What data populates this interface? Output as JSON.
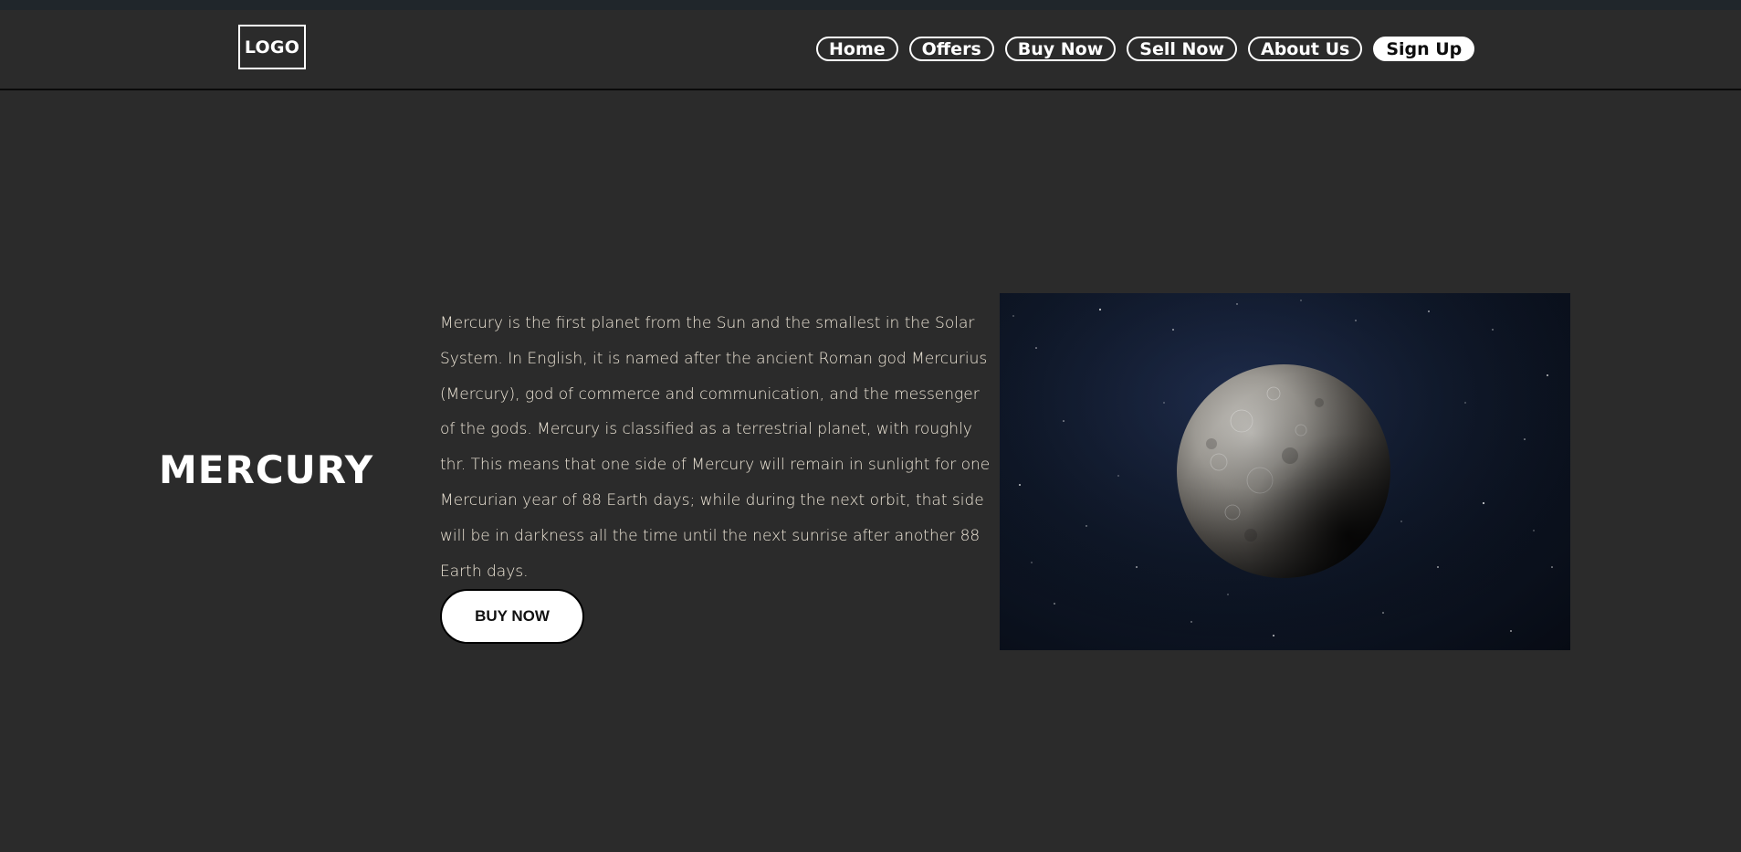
{
  "header": {
    "logo_text": "LOGO",
    "nav": [
      {
        "label": "Home"
      },
      {
        "label": "Offers"
      },
      {
        "label": "Buy Now"
      },
      {
        "label": "Sell Now"
      },
      {
        "label": "About Us"
      },
      {
        "label": "Sign Up"
      }
    ]
  },
  "main": {
    "title": "mercury",
    "description": "Mercury is the first planet from the Sun and the smallest in the Solar System. In English, it is named after the ancient Roman god Mercurius (Mercury), god of commerce and communication, and the messenger of the gods. Mercury is classified as a terrestrial planet, with roughly thr. This means that one side of Mercury will remain in sunlight for one Mercurian year of 88 Earth days; while during the next orbit, that side will be in darkness all the time until the next sunrise after another 88 Earth days.",
    "buy_button_label": "BUY NOW",
    "image_icon": "planet-mercury"
  },
  "colors": {
    "page_background": "#2b2b2b",
    "top_strip": "#20262b",
    "text": "#ffffff",
    "description_text": "#efe7d8",
    "button_fill": "#ffffff"
  }
}
